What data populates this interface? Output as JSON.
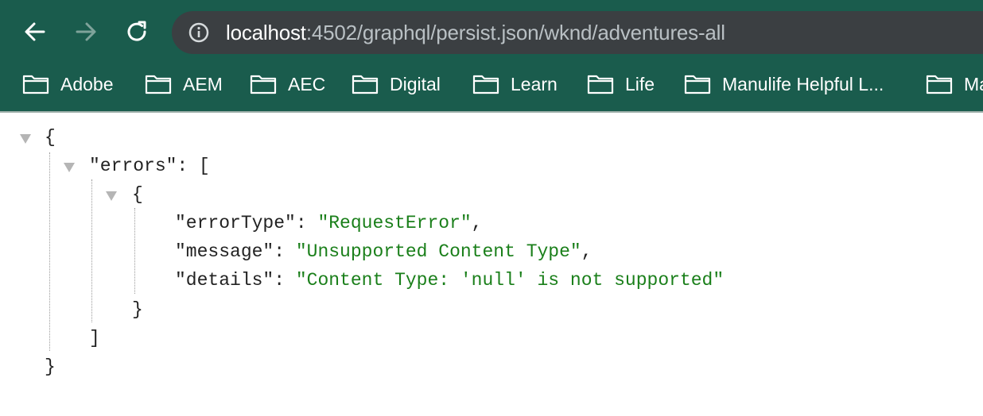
{
  "browser": {
    "url_host": "localhost",
    "url_rest": ":4502/graphql/persist.json/wknd/adventures-all",
    "bookmarks": [
      "Adobe",
      "AEM",
      "AEC",
      "Digital",
      "Learn",
      "Life",
      "Manulife Helpful L...",
      "Ma"
    ],
    "colors": {
      "toolbar": "#1a5c4d",
      "urlbar": "#3b3f42"
    }
  },
  "json_view": {
    "open_brace": "{",
    "errors_key": "\"errors\"",
    "colon_bracket": ": [",
    "inner_open": "{",
    "key_errorType": "\"errorType\"",
    "val_errorType": "\"RequestError\"",
    "key_message": "\"message\"",
    "val_message": "\"Unsupported Content Type\"",
    "key_details": "\"details\"",
    "val_details": "\"Content Type: 'null' is not supported\"",
    "colon": ": ",
    "comma": ",",
    "inner_close": "}",
    "array_close": "]",
    "close_brace": "}"
  }
}
